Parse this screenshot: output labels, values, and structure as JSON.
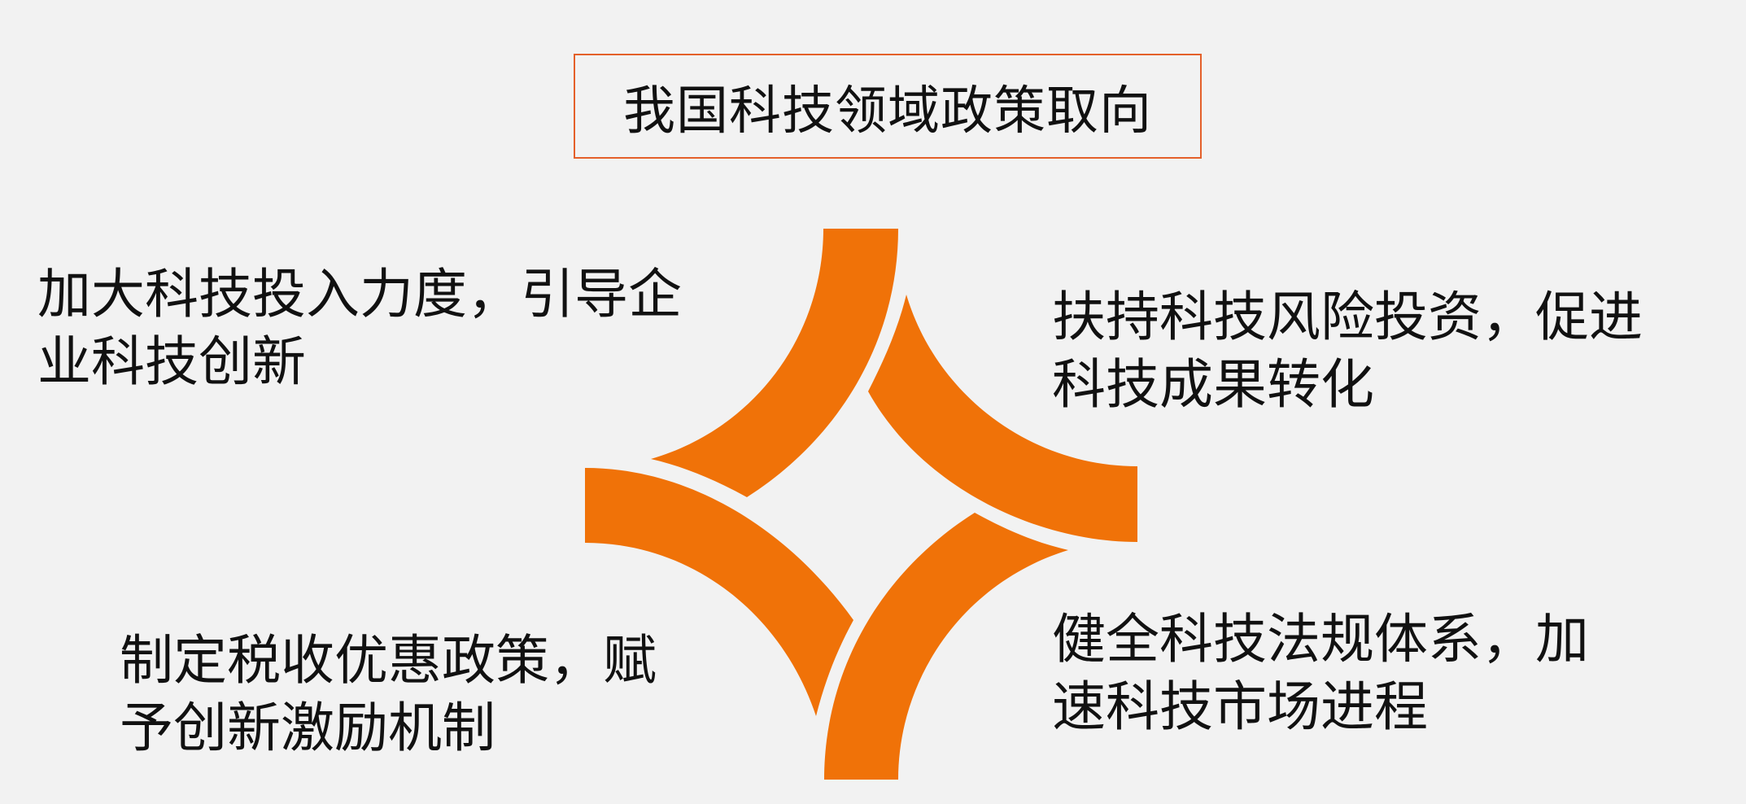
{
  "title": "我国科技领域政策取向",
  "accent_color": "#f07208",
  "border_color": "#e4602a",
  "quadrants": {
    "top_left": "加大科技投入力度，引导企\n业科技创新",
    "top_right": "扶持科技风险投资，促进\n科技成果转化",
    "bottom_left": "制定税收优惠政策，赋\n予创新激励机制",
    "bottom_right": "健全科技法规体系，加\n速科技市场进程"
  }
}
